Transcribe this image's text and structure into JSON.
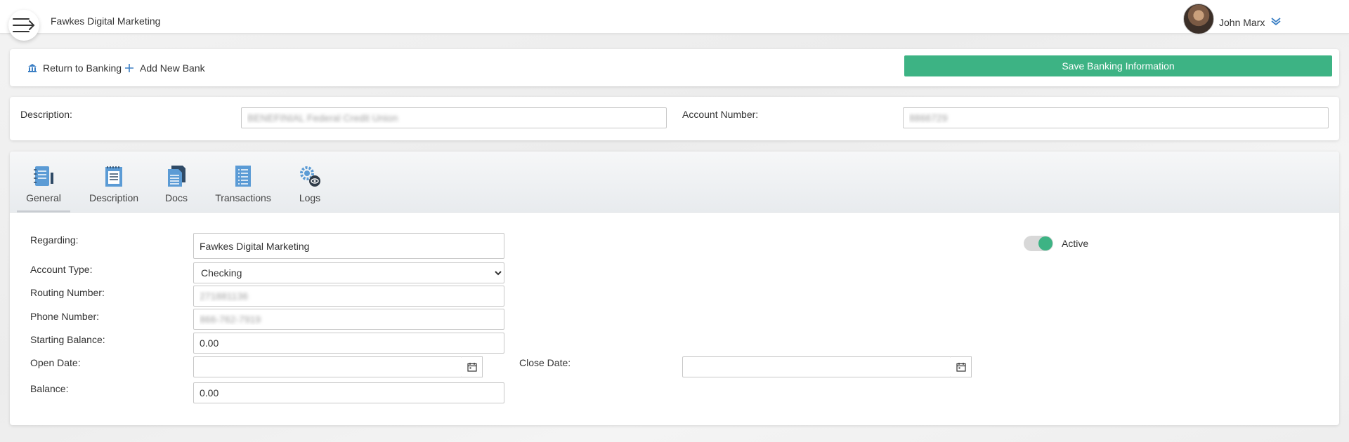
{
  "header": {
    "company": "Fawkes Digital Marketing",
    "user_name": "John Marx",
    "icons": {
      "menu": "menu-arrow-icon",
      "user_dropdown": "chevron-down-icon"
    }
  },
  "actions": {
    "return_label": "Return to Banking",
    "add_label": "Add New Bank",
    "save_label": "Save Banking Information"
  },
  "summary": {
    "description_label": "Description:",
    "description_value": "BENEFINIAL Federal Credit Union",
    "account_number_label": "Account Number:",
    "account_number_value": "8866729"
  },
  "tabs": [
    {
      "label": "General",
      "icon": "notebook-icon",
      "active": true
    },
    {
      "label": "Description",
      "icon": "notepad-icon"
    },
    {
      "label": "Docs",
      "icon": "documents-icon"
    },
    {
      "label": "Transactions",
      "icon": "list-icon"
    },
    {
      "label": "Logs",
      "icon": "gear-eye-icon"
    }
  ],
  "general": {
    "regarding_label": "Regarding:",
    "regarding_value": "Fawkes Digital Marketing",
    "account_type_label": "Account Type:",
    "account_type_value": "Checking",
    "routing_label": "Routing Number:",
    "routing_value": "271881136",
    "phone_label": "Phone Number:",
    "phone_value": "866-762-7919",
    "starting_balance_label": "Starting Balance:",
    "starting_balance_value": "0.00",
    "open_date_label": "Open Date:",
    "open_date_value": "",
    "close_date_label": "Close Date:",
    "close_date_value": "",
    "balance_label": "Balance:",
    "balance_value": "0.00",
    "active_label": "Active",
    "active_on": true
  },
  "colors": {
    "accent": "#3db384",
    "icon_blue": "#5b9bd5"
  }
}
